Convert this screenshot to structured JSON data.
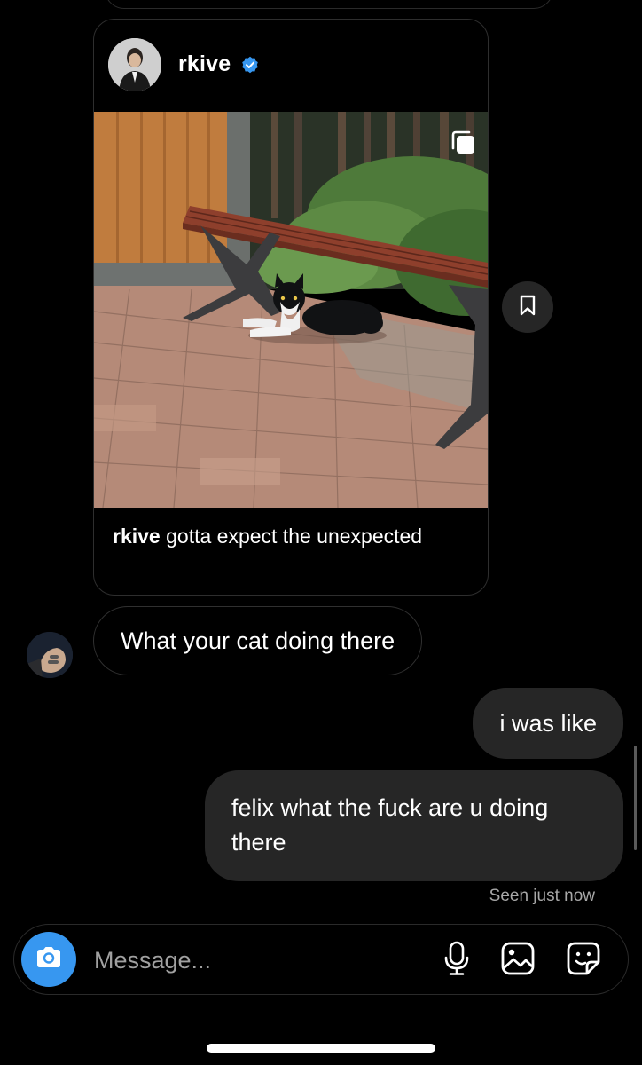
{
  "post": {
    "username": "rkive",
    "verified": true,
    "caption_username": "rkive",
    "caption_text": "gotta expect the unexpected",
    "image_description_icon": "carousel-icon"
  },
  "messages": [
    {
      "direction": "incoming",
      "text": "What your cat doing there"
    },
    {
      "direction": "outgoing",
      "text": "i was like"
    },
    {
      "direction": "outgoing",
      "text": "felix what the fuck are u doing there"
    }
  ],
  "status": {
    "seen": "Seen just now"
  },
  "composer": {
    "placeholder": "Message..."
  },
  "colors": {
    "accent": "#3797f0",
    "bubble_outgoing": "#262626",
    "background": "#000000",
    "verified": "#3797f0"
  },
  "icons": [
    "save-icon",
    "verified-icon",
    "camera-icon",
    "microphone-icon",
    "gallery-icon",
    "sticker-icon",
    "carousel-icon"
  ]
}
